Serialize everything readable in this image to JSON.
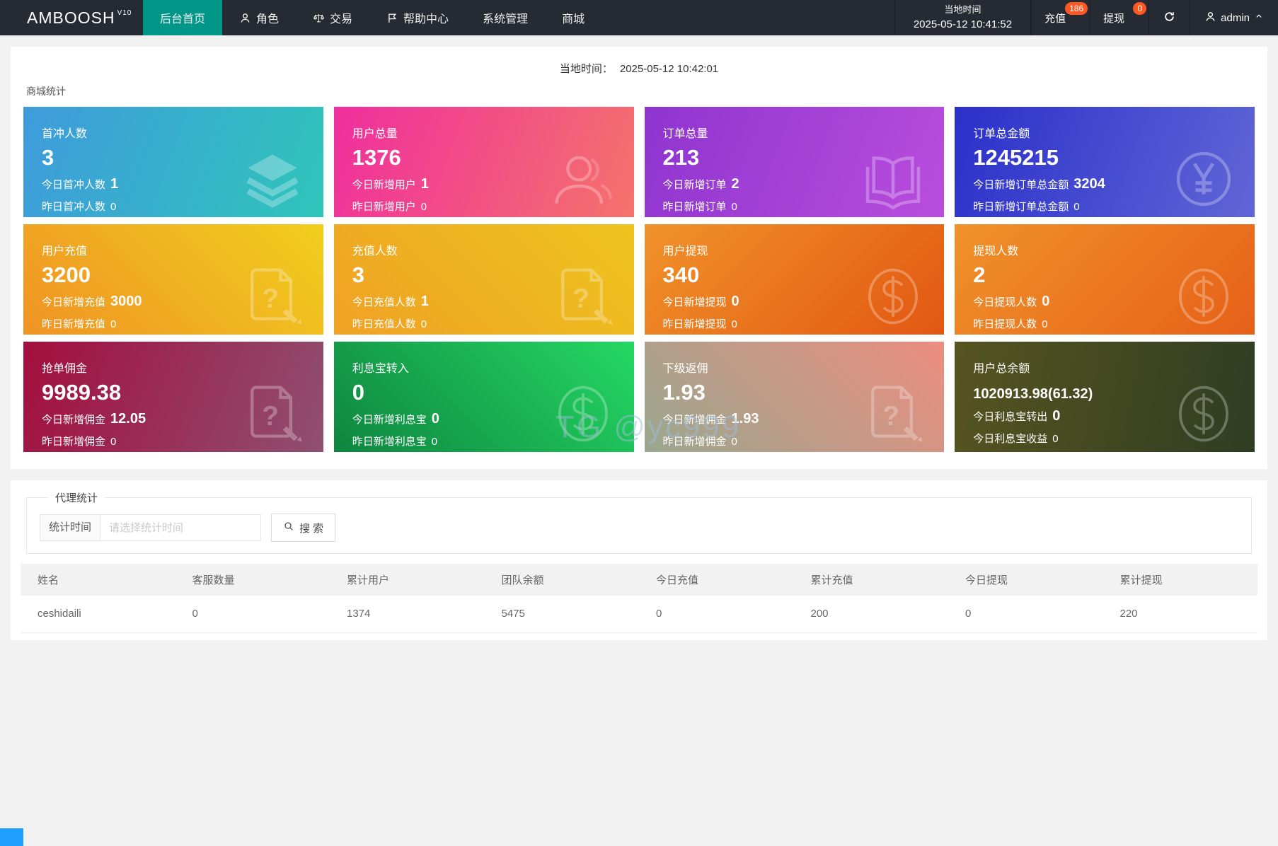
{
  "navbar": {
    "logo": "AMBOOSH",
    "logo_sup": "V10",
    "items": [
      {
        "name": "home",
        "label": "后台首页",
        "active": true
      },
      {
        "name": "roles",
        "label": "角色",
        "icon": "nav-user-icon"
      },
      {
        "name": "trade",
        "label": "交易",
        "icon": "nav-scales-icon"
      },
      {
        "name": "help-center",
        "label": "帮助中心",
        "icon": "nav-flag-icon"
      },
      {
        "name": "system-management",
        "label": "系统管理"
      },
      {
        "name": "mall",
        "label": "商城"
      }
    ],
    "local_time_label": "当地时间",
    "local_time_value": "2025-05-12 10:41:52",
    "recharge_label": "充值",
    "recharge_badge": "186",
    "withdraw_label": "提现",
    "withdraw_badge": "0",
    "username": "admin",
    "colors": {
      "navbar_bg": "#262a32",
      "active_bg": "#009688",
      "badge_bg": "#ff5722"
    }
  },
  "stats_panel": {
    "time_label": "当地时间：",
    "time_value": "2025-05-12 10:42:01",
    "section_title": "商城统计",
    "watermark": "TG @yc999",
    "cards": [
      {
        "name": "first-charge-users",
        "title": "首冲人数",
        "value": "3",
        "today_label": "今日首冲人数",
        "today_value": "1",
        "yesterday_label": "昨日首冲人数",
        "yesterday_value": "0",
        "icon": "layers-icon",
        "gradient": {
          "angle": "110deg",
          "from": "#3f9bdc",
          "to": "#2fc5ba"
        }
      },
      {
        "name": "total-users",
        "title": "用户总量",
        "value": "1376",
        "today_label": "今日新增用户",
        "today_value": "1",
        "yesterday_label": "昨日新增用户",
        "yesterday_value": "0",
        "icon": "users-icon",
        "gradient": {
          "angle": "110deg",
          "from": "#f02e9e",
          "to": "#f4736b"
        }
      },
      {
        "name": "total-orders",
        "title": "订单总量",
        "value": "213",
        "today_label": "今日新增订单",
        "today_value": "2",
        "yesterday_label": "昨日新增订单",
        "yesterday_value": "0",
        "icon": "book-icon",
        "gradient": {
          "angle": "110deg",
          "from": "#8e35cf",
          "to": "#b94ddd"
        }
      },
      {
        "name": "total-order-amount",
        "title": "订单总金额",
        "value": "1245215",
        "today_label": "今日新增订单总金额",
        "today_value": "3204",
        "yesterday_label": "昨日新增订单总金额",
        "yesterday_value": "0",
        "icon": "yen-circle-icon",
        "gradient": {
          "angle": "110deg",
          "from": "#2a30c9",
          "to": "#6066d6"
        }
      },
      {
        "name": "user-recharge",
        "title": "用户充值",
        "value": "3200",
        "today_label": "今日新增充值",
        "today_value": "3000",
        "yesterday_label": "昨日新增充值",
        "yesterday_value": "0",
        "icon": "doc-edit-icon",
        "gradient": {
          "angle": "45deg",
          "from": "#f09324",
          "to": "#f0cf1d"
        }
      },
      {
        "name": "recharge-users",
        "title": "充值人数",
        "value": "3",
        "today_label": "今日充值人数",
        "today_value": "1",
        "yesterday_label": "昨日充值人数",
        "yesterday_value": "0",
        "icon": "doc-edit-icon",
        "gradient": {
          "angle": "45deg",
          "from": "#f0a125",
          "to": "#edc41d"
        }
      },
      {
        "name": "user-withdraw",
        "title": "用户提现",
        "value": "340",
        "today_label": "今日新增提现",
        "today_value": "0",
        "yesterday_label": "昨日新增提现",
        "yesterday_value": "0",
        "icon": "dollar-circle-icon",
        "gradient": {
          "angle": "135deg",
          "from": "#f0922a",
          "to": "#e25712"
        }
      },
      {
        "name": "withdraw-users",
        "title": "提现人数",
        "value": "2",
        "today_label": "今日提现人数",
        "today_value": "0",
        "yesterday_label": "昨日提现人数",
        "yesterday_value": "0",
        "icon": "dollar-circle-icon",
        "gradient": {
          "angle": "135deg",
          "from": "#f0922a",
          "to": "#e66018"
        }
      },
      {
        "name": "order-commission",
        "title": "抢单佣金",
        "value": "9989.38",
        "today_label": "今日新增佣金",
        "today_value": "12.05",
        "yesterday_label": "昨日新增佣金",
        "yesterday_value": "0",
        "icon": "doc-edit-icon",
        "gradient": {
          "angle": "110deg",
          "from": "#a30e3e",
          "to": "#8f5070"
        }
      },
      {
        "name": "interest-transfer-in",
        "title": "利息宝转入",
        "value": "0",
        "today_label": "今日新增利息宝",
        "today_value": "0",
        "yesterday_label": "昨日新增利息宝",
        "yesterday_value": "0",
        "icon": "dollar-circle-icon",
        "gradient": {
          "angle": "45deg",
          "from": "#0e8540",
          "to": "#25d863"
        }
      },
      {
        "name": "sub-rebate",
        "title": "下级返佣",
        "value": "1.93",
        "today_label": "今日新增佣金",
        "today_value": "1.93",
        "yesterday_label": "昨日新增佣金",
        "yesterday_value": "0",
        "icon": "doc-edit-icon",
        "gradient": {
          "angle": "45deg",
          "from": "#9aa78e",
          "to": "#ec8d80"
        }
      },
      {
        "name": "user-total-balance",
        "title": "用户总余额",
        "value": "1020913.98(61.32)",
        "small_value": true,
        "today_label": "今日利息宝转出",
        "today_value": "0",
        "yesterday_label": "今日利息宝收益",
        "yesterday_value": "0",
        "icon": "dollar-circle-icon",
        "gradient": {
          "angle": "100deg",
          "from": "#565420",
          "to": "#2f3d22"
        }
      }
    ]
  },
  "agent_panel": {
    "legend": "代理统计",
    "filter_label": "统计时间",
    "filter_placeholder": "请选择统计时间",
    "search_label": "搜 索",
    "table": {
      "col_names": [
        "agent-name",
        "service-count",
        "total-users",
        "team-balance",
        "today-recharge",
        "total-recharge",
        "today-withdraw",
        "total-withdraw"
      ],
      "headers": [
        "姓名",
        "客服数量",
        "累计用户",
        "团队余额",
        "今日充值",
        "累计充值",
        "今日提现",
        "累计提现"
      ],
      "rows": [
        [
          "ceshidaili",
          "0",
          "1374",
          "5475",
          "0",
          "200",
          "0",
          "220"
        ]
      ]
    }
  }
}
